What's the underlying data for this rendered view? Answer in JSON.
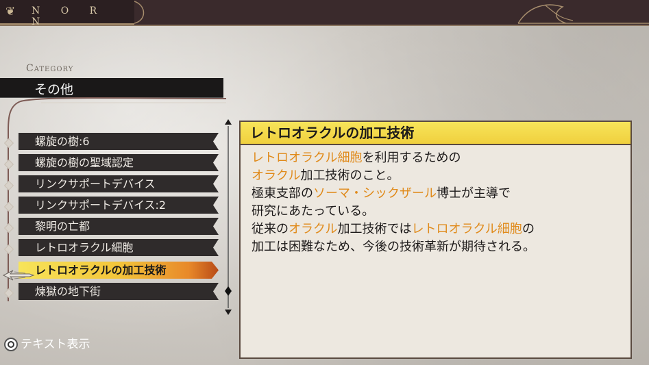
{
  "header": {
    "title": "N O R N"
  },
  "category": {
    "label": "Category",
    "value": "その他"
  },
  "list": {
    "items": [
      "螺旋の樹:6",
      "螺旋の樹の聖域認定",
      "リンクサポートデバイス",
      "リンクサポートデバイス:2",
      "黎明の亡都",
      "レトロオラクル細胞",
      "レトロオラクルの加工技術",
      "煉獄の地下街"
    ],
    "selected_index": 6
  },
  "detail": {
    "title": "レトロオラクルの加工技術",
    "lines": [
      [
        {
          "t": "レトロオラクル細胞",
          "h": true
        },
        {
          "t": "を利用するための",
          "h": false
        }
      ],
      [
        {
          "t": "オラクル",
          "h": true
        },
        {
          "t": "加工技術のこと。",
          "h": false
        }
      ],
      [
        {
          "t": "極東支部の",
          "h": false
        },
        {
          "t": "ソーマ・シックザール",
          "h": true
        },
        {
          "t": "博士が主導で",
          "h": false
        }
      ],
      [
        {
          "t": "研究にあたっている。",
          "h": false
        }
      ],
      [
        {
          "t": "従来の",
          "h": false
        },
        {
          "t": "オラクル",
          "h": true
        },
        {
          "t": "加工技術では",
          "h": false
        },
        {
          "t": "レトロオラクル細胞",
          "h": true
        },
        {
          "t": "の",
          "h": false
        }
      ],
      [
        {
          "t": "加工は困難なため、今後の技術革新が期待される。",
          "h": false
        }
      ]
    ]
  },
  "footer": {
    "hint": "テキスト表示"
  },
  "colors": {
    "accent": "#f3d13e",
    "highlight": "#e08a1a",
    "topbar": "#3a2a2c"
  }
}
